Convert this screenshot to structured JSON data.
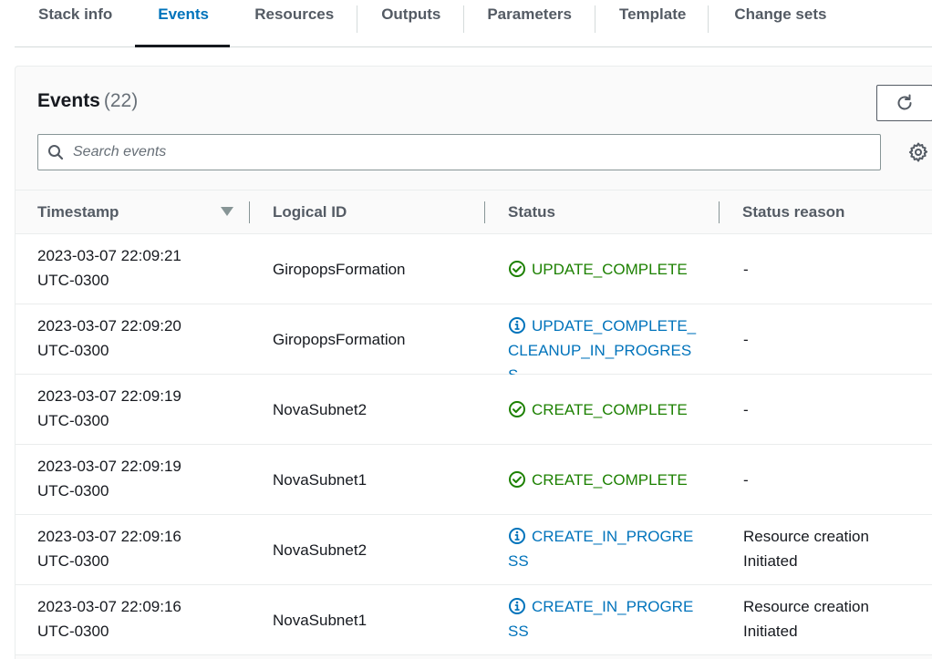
{
  "tabs": [
    {
      "label": "Stack info",
      "active": false
    },
    {
      "label": "Events",
      "active": true
    },
    {
      "label": "Resources",
      "active": false
    },
    {
      "label": "Outputs",
      "active": false
    },
    {
      "label": "Parameters",
      "active": false
    },
    {
      "label": "Template",
      "active": false
    },
    {
      "label": "Change sets",
      "active": false
    }
  ],
  "panel": {
    "title": "Events",
    "count": "(22)",
    "refresh_icon": "refresh-icon",
    "settings_icon": "gear-icon"
  },
  "search": {
    "placeholder": "Search events",
    "value": "",
    "icon": "search-icon"
  },
  "table": {
    "columns": [
      "Timestamp",
      "Logical ID",
      "Status",
      "Status reason"
    ],
    "sort_column": "Timestamp",
    "sort_direction": "descending",
    "rows": [
      {
        "timestamp": "2023-03-07 22:09:21",
        "tz": "UTC-0300",
        "logical_id": "GiropopsFormation",
        "status": "UPDATE_COMPLETE",
        "status_kind": "success",
        "reason": "-",
        "reason2": ""
      },
      {
        "timestamp": "2023-03-07 22:09:20",
        "tz": "UTC-0300",
        "logical_id": "GiropopsFormation",
        "status": "UPDATE_COMPLETE_CLEANUP_IN_PROGRESS",
        "status_kind": "info",
        "reason": "-",
        "reason2": ""
      },
      {
        "timestamp": "2023-03-07 22:09:19",
        "tz": "UTC-0300",
        "logical_id": "NovaSubnet2",
        "status": "CREATE_COMPLETE",
        "status_kind": "success",
        "reason": "-",
        "reason2": ""
      },
      {
        "timestamp": "2023-03-07 22:09:19",
        "tz": "UTC-0300",
        "logical_id": "NovaSubnet1",
        "status": "CREATE_COMPLETE",
        "status_kind": "success",
        "reason": "-",
        "reason2": ""
      },
      {
        "timestamp": "2023-03-07 22:09:16",
        "tz": "UTC-0300",
        "logical_id": "NovaSubnet2",
        "status": "CREATE_IN_PROGRESS",
        "status_kind": "info",
        "reason": "Resource creation",
        "reason2": "Initiated"
      },
      {
        "timestamp": "2023-03-07 22:09:16",
        "tz": "UTC-0300",
        "logical_id": "NovaSubnet1",
        "status": "CREATE_IN_PROGRESS",
        "status_kind": "info",
        "reason": "Resource creation",
        "reason2": "Initiated"
      }
    ]
  },
  "colors": {
    "accent": "#0073bb",
    "success": "#1d8102",
    "tab_underline": "#16191f"
  }
}
